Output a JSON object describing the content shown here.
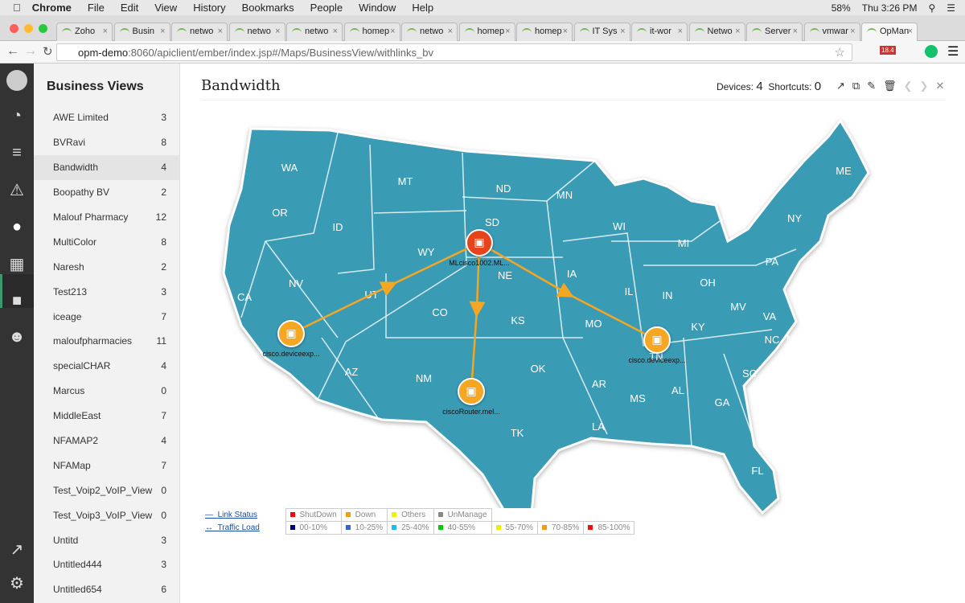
{
  "menubar": {
    "app": "Chrome",
    "items": [
      "File",
      "Edit",
      "View",
      "History",
      "Bookmarks",
      "People",
      "Window",
      "Help"
    ],
    "battery": "58%",
    "clock": "Thu 3:26 PM"
  },
  "tabs": [
    "Zoho",
    "Busin",
    "netwo",
    "netwo",
    "netwo",
    "homep",
    "netwo",
    "homep",
    "homep",
    "IT Sys",
    "it-wor",
    "Netwo",
    "Server",
    "vmwar",
    "OpMan"
  ],
  "address": {
    "host": "opm-demo",
    "rest": ":8060/apiclient/ember/index.jsp#/Maps/BusinessView/withlinks_bv",
    "badge": "18.4"
  },
  "sidebar": {
    "title": "Business Views",
    "selected": "Bandwidth",
    "items": [
      {
        "label": "AWE Limited",
        "count": "3"
      },
      {
        "label": "BVRavi",
        "count": "8"
      },
      {
        "label": "Bandwidth",
        "count": "4"
      },
      {
        "label": "Boopathy BV",
        "count": "2"
      },
      {
        "label": "Malouf Pharmacy",
        "count": "12"
      },
      {
        "label": "MultiColor",
        "count": "8"
      },
      {
        "label": "Naresh",
        "count": "2"
      },
      {
        "label": "Test213",
        "count": "3"
      },
      {
        "label": "iceage",
        "count": "7"
      },
      {
        "label": "maloufpharmacies",
        "count": "11"
      },
      {
        "label": "specialCHAR",
        "count": "4"
      },
      {
        "label": "Marcus",
        "count": "0"
      },
      {
        "label": "MiddleEast",
        "count": "7"
      },
      {
        "label": "NFAMAP2",
        "count": "4"
      },
      {
        "label": "NFAMap",
        "count": "7"
      },
      {
        "label": "Test_Voip2_VoIP_View",
        "count": "0"
      },
      {
        "label": "Test_Voip3_VoIP_View",
        "count": "0"
      },
      {
        "label": "Untitd",
        "count": "3"
      },
      {
        "label": "Untitled444",
        "count": "3"
      },
      {
        "label": "Untitled654",
        "count": "6"
      }
    ]
  },
  "view": {
    "title": "Bandwidth",
    "devices_label": "Devices:",
    "devices": "4",
    "shortcuts_label": "Shortcuts:",
    "shortcuts": "0"
  },
  "states": [
    "WA",
    "OR",
    "CA",
    "NV",
    "ID",
    "MT",
    "WY",
    "UT",
    "CO",
    "AZ",
    "NM",
    "ND",
    "SD",
    "NE",
    "KS",
    "OK",
    "TK",
    "MN",
    "IA",
    "MO",
    "AR",
    "LA",
    "WI",
    "IL",
    "MI",
    "IN",
    "OH",
    "KY",
    "TN",
    "MS",
    "AL",
    "GA",
    "FL",
    "SC",
    "NC",
    "VA",
    "MV",
    "PA",
    "NY",
    "ME",
    "MC"
  ],
  "devices": [
    {
      "name": "cisco.deviceexp...",
      "status": "down",
      "color": "#f5a623"
    },
    {
      "name": "MLcisco1002.ML...",
      "status": "shutdown",
      "color": "#e8441b"
    },
    {
      "name": "ciscoRouter.mel...",
      "status": "down",
      "color": "#f5a623"
    },
    {
      "name": "cisco.deviceexp...",
      "status": "down",
      "color": "#f5a623"
    }
  ],
  "legend": {
    "link_status": "Link Status",
    "traffic_load": "Traffic Load",
    "status": [
      {
        "label": "ShutDown",
        "color": "#ff0000"
      },
      {
        "label": "Down",
        "color": "#f39c12"
      },
      {
        "label": "Others",
        "color": "#f0f000"
      },
      {
        "label": "UnManage",
        "color": "#888888"
      }
    ],
    "load": [
      {
        "label": "00-10%",
        "color": "#000080"
      },
      {
        "label": "10-25%",
        "color": "#3366cc"
      },
      {
        "label": "25-40%",
        "color": "#22bbee"
      },
      {
        "label": "40-55%",
        "color": "#00cc00"
      },
      {
        "label": "55-70%",
        "color": "#eeee00"
      },
      {
        "label": "70-85%",
        "color": "#f39c12"
      },
      {
        "label": "85-100%",
        "color": "#ee1111"
      }
    ]
  },
  "colors": {
    "map": "#3a9bb5",
    "link": "#f5a623"
  }
}
